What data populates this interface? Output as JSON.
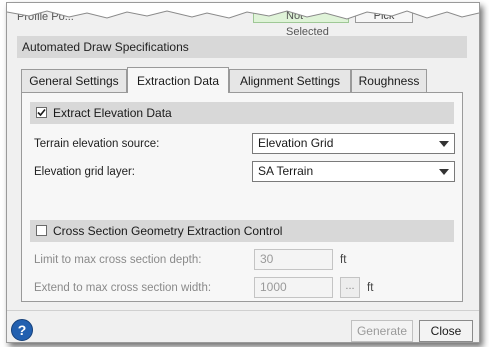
{
  "background_strip": {
    "label": "Profile Po...",
    "field_value": "Not Selected",
    "pick_label": "Pick"
  },
  "section_title": "Automated Draw Specifications",
  "tabs": [
    {
      "label": "General Settings",
      "active": false
    },
    {
      "label": "Extraction Data",
      "active": true
    },
    {
      "label": "Alignment Settings",
      "active": false
    },
    {
      "label": "Roughness",
      "active": false
    }
  ],
  "extract_elevation": {
    "label": "Extract Elevation Data",
    "checked": true,
    "terrain_source_label": "Terrain elevation source:",
    "terrain_source_value": "Elevation Grid",
    "grid_layer_label": "Elevation grid layer:",
    "grid_layer_value": "SA Terrain"
  },
  "cross_section": {
    "label": "Cross Section Geometry Extraction Control",
    "checked": false,
    "depth_label": "Limit to max cross section depth:",
    "depth_value": "30",
    "depth_unit": "ft",
    "width_label": "Extend to max cross section width:",
    "width_value": "1000",
    "width_button": "...",
    "width_unit": "ft"
  },
  "footer": {
    "help_glyph": "?",
    "generate_label": "Generate",
    "close_label": "Close"
  },
  "colors": {
    "dialog_bg": "#f0f0f0",
    "header_bg": "#d8d8d8",
    "help_blue": "#2260b0"
  }
}
